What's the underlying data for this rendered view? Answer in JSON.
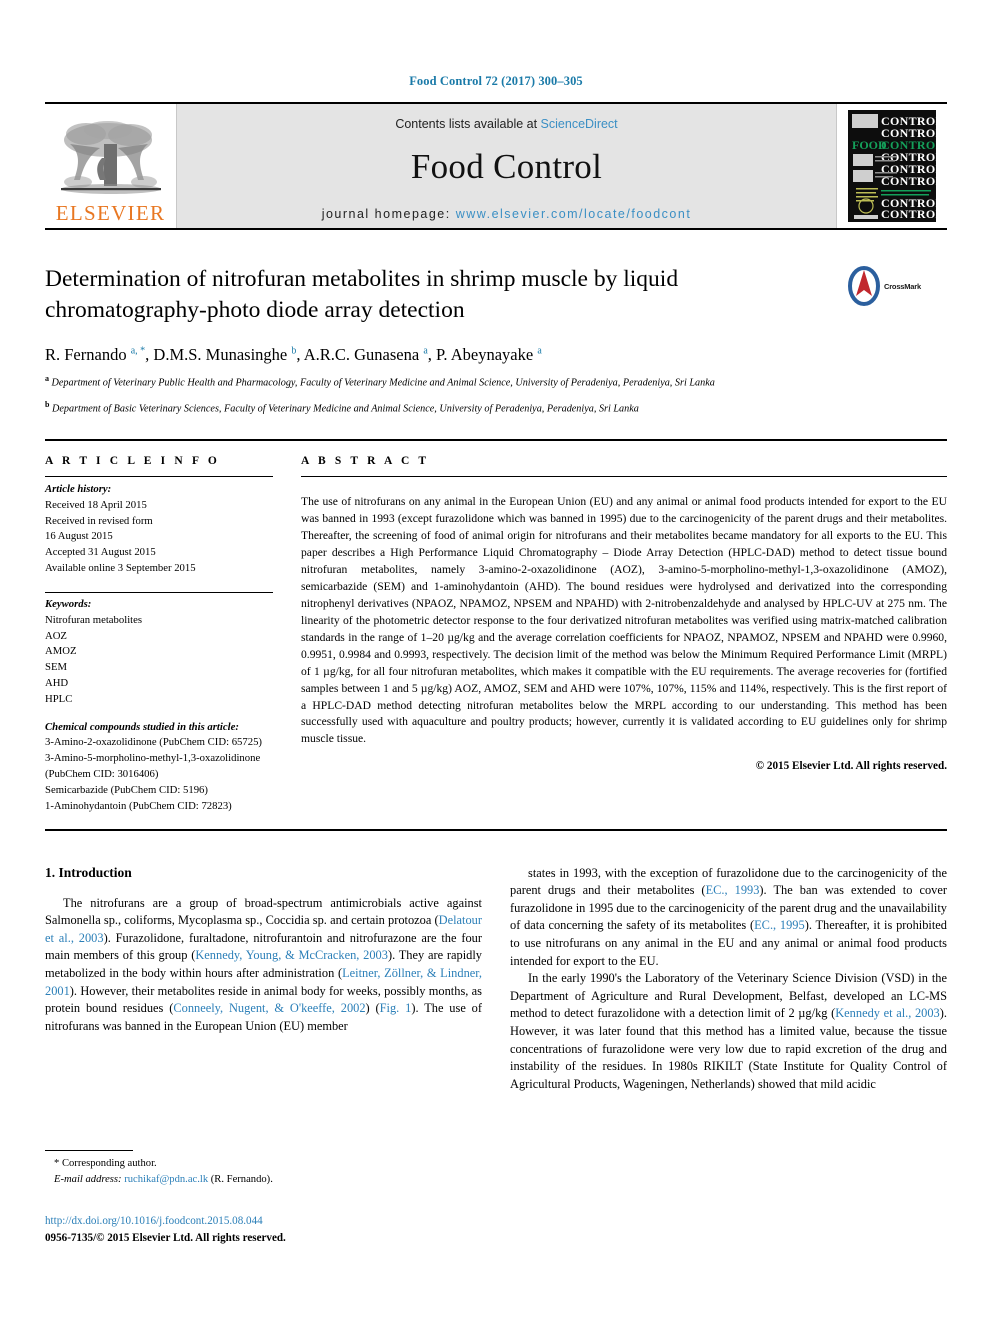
{
  "running_head": "Food Control 72 (2017) 300–305",
  "masthead": {
    "publisher_name": "ELSEVIER",
    "contents_prefix": "Contents lists available at ",
    "contents_link": "ScienceDirect",
    "journal_name": "Food Control",
    "homepage_prefix": "journal homepage: ",
    "homepage_url": "www.elsevier.com/locate/foodcont",
    "cover_food": "FOOD",
    "cover_control": "CONTROL"
  },
  "article": {
    "title": "Determination of nitrofuran metabolites in shrimp muscle by liquid chromatography-photo diode array detection",
    "crossmark_label": "CrossMark",
    "authors_html": "R. Fernando <sup>a, *</sup>, D.M.S. Munasinghe <sup>b</sup>, A.R.C. Gunasena <sup>a</sup>, P. Abeynayake <sup>a</sup>",
    "affiliation_a": "Department of Veterinary Public Health and Pharmacology, Faculty of Veterinary Medicine and Animal Science, University of Peradeniya, Peradeniya, Sri Lanka",
    "affiliation_b": "Department of Basic Veterinary Sciences, Faculty of Veterinary Medicine and Animal Science, University of Peradeniya, Peradeniya, Sri Lanka"
  },
  "info": {
    "heading": "A R T I C L E   I N F O",
    "history_label": "Article history:",
    "history": [
      "Received 18 April 2015",
      "Received in revised form",
      "16 August 2015",
      "Accepted 31 August 2015",
      "Available online 3 September 2015"
    ],
    "keywords_label": "Keywords:",
    "keywords": [
      "Nitrofuran metabolites",
      "AOZ",
      "AMOZ",
      "SEM",
      "AHD",
      "HPLC"
    ],
    "compounds_label": "Chemical compounds studied in this article:",
    "compounds": [
      "3-Amino-2-oxazolidinone (PubChem CID: 65725)",
      "3-Amino-5-morpholino-methyl-1,3-oxazolidinone (PubChem CID: 3016406)",
      "Semicarbazide (PubChem CID: 5196)",
      "1-Aminohydantoin (PubChem CID: 72823)"
    ]
  },
  "abstract": {
    "heading": "A B S T R A C T",
    "text": "The use of nitrofurans on any animal in the European Union (EU) and any animal or animal food products intended for export to the EU was banned in 1993 (except furazolidone which was banned in 1995) due to the carcinogenicity of the parent drugs and their metabolites. Thereafter, the screening of food of animal origin for nitrofurans and their metabolites became mandatory for all exports to the EU. This paper describes a High Performance Liquid Chromatography – Diode Array Detection (HPLC-DAD) method to detect tissue bound nitrofuran metabolites, namely 3-amino-2-oxazolidinone (AOZ), 3-amino-5-morpholino-methyl-1,3-oxazolidinone (AMOZ), semicarbazide (SEM) and 1-aminohydantoin (AHD). The bound residues were hydrolysed and derivatized into the corresponding nitrophenyl derivatives (NPAOZ, NPAMOZ, NPSEM and NPAHD) with 2-nitrobenzaldehyde and analysed by HPLC-UV at 275 nm. The linearity of the photometric detector response to the four derivatized nitrofuran metabolites was verified using matrix-matched calibration standards in the range of 1–20 µg/kg and the average correlation coefficients for NPAOZ, NPAMOZ, NPSEM and NPAHD were 0.9960, 0.9951, 0.9984 and 0.9993, respectively. The decision limit of the method was below the Minimum Required Performance Limit (MRPL) of 1 µg/kg, for all four nitrofuran metabolites, which makes it compatible with the EU requirements. The average recoveries for (fortified samples between 1 and 5 µg/kg) AOZ, AMOZ, SEM and AHD were 107%, 107%, 115% and 114%, respectively. This is the first report of a HPLC-DAD method detecting nitrofuran metabolites below the MRPL according to our understanding. This method has been successfully used with aquaculture and poultry products; however, currently it is validated according to EU guidelines only for shrimp muscle tissue.",
    "copyright": "© 2015 Elsevier Ltd. All rights reserved."
  },
  "body": {
    "section_heading": "1. Introduction",
    "left_paragraph_html": "The nitrofurans are a group of broad-spectrum antimicrobials active against Salmonella sp., coliforms, Mycoplasma sp., Coccidia sp. and certain protozoa (<span class=\"ref\">Delatour et al., 2003</span>). Furazolidone, furaltadone, nitrofurantoin and nitrofurazone are the four main members of this group (<span class=\"ref\">Kennedy, Young, &amp; McCracken, 2003</span>). They are rapidly metabolized in the body within hours after administration (<span class=\"ref\">Leitner, Zöllner, &amp; Lindner, 2001</span>). However, their metabolites reside in animal body for weeks, possibly months, as protein bound residues (<span class=\"ref\">Conneely, Nugent, &amp; O'keeffe, 2002</span>) (<span class=\"ref\">Fig. 1</span>). The use of nitrofurans was banned in the European Union (EU) member",
    "right_paragraph_1_html": "states in 1993, with the exception of furazolidone due to the carcinogenicity of the parent drugs and their metabolites (<span class=\"ref\">EC., 1993</span>). The ban was extended to cover furazolidone in 1995 due to the carcinogenicity of the parent drug and the unavailability of data concerning the safety of its metabolites (<span class=\"ref\">EC., 1995</span>). Thereafter, it is prohibited to use nitrofurans on any animal in the EU and any animal or animal food products intended for export to the EU.",
    "right_paragraph_2_html": "In the early 1990's the Laboratory of the Veterinary Science Division (VSD) in the Department of Agriculture and Rural Development, Belfast, developed an LC-MS method to detect furazolidone with a detection limit of 2 µg/kg (<span class=\"ref\">Kennedy et al., 2003</span>). However, it was later found that this method has a limited value, because the tissue concentrations of furazolidone were very low due to rapid excretion of the drug and instability of the residues. In 1980s RIKILT (State Institute for Quality Control of Agricultural Products, Wageningen, Netherlands) showed that mild acidic"
  },
  "footer": {
    "corresponding_author": "* Corresponding author.",
    "email_label": "E-mail address:",
    "email": "ruchikaf@pdn.ac.lk",
    "email_suffix": "(R. Fernando).",
    "doi_url": "http://dx.doi.org/10.1016/j.foodcont.2015.08.044",
    "issn_line": "0956-7135/© 2015 Elsevier Ltd. All rights reserved."
  },
  "colors": {
    "link_blue": "#2b7fb8",
    "elsevier_orange": "#e87722",
    "running_head_blue": "#1a7aa8",
    "band_gray": "#e4e4e4"
  }
}
